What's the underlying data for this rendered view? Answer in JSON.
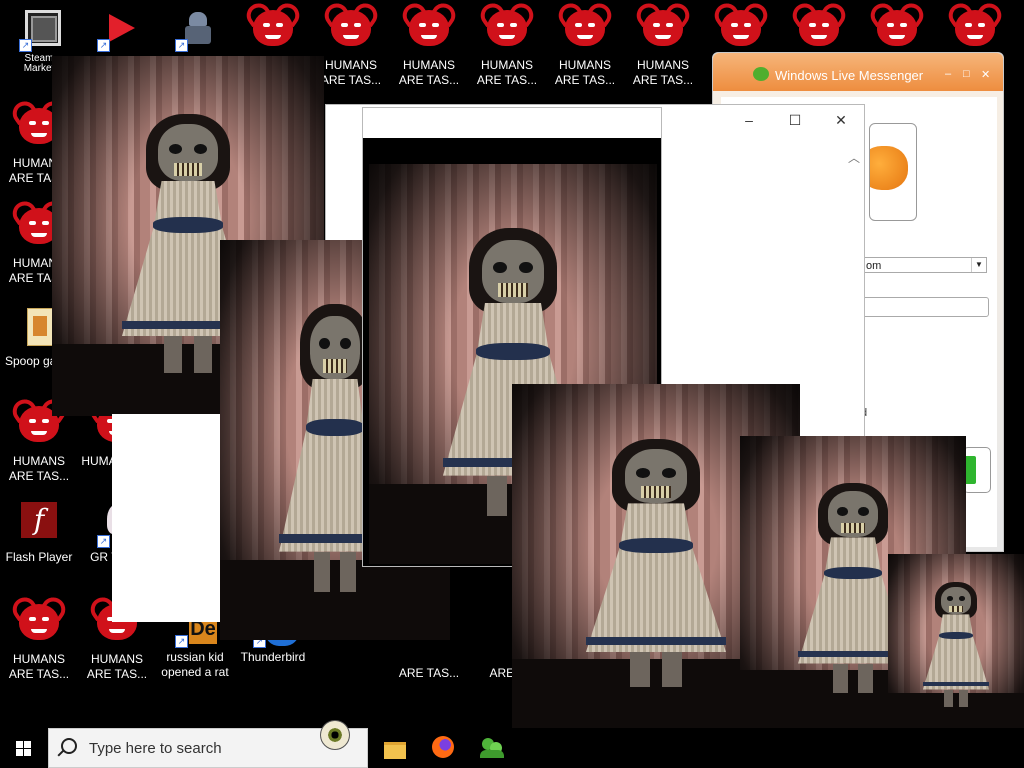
{
  "desktop": {
    "icons": [
      {
        "label": "HUMANS ARE TAS...",
        "type": "demon"
      },
      {
        "label": "HUMANS ARE TAS...",
        "type": "demon"
      },
      {
        "label": "Spoop game",
        "type": "game"
      },
      {
        "label": "HUMANS ARE TAS...",
        "type": "demon"
      },
      {
        "label": "HUMAN ARE T",
        "type": "demon"
      },
      {
        "label": "Flash Player",
        "type": "flash"
      },
      {
        "label": "GR THER",
        "type": "other"
      },
      {
        "label": "HUMANS ARE TAS...",
        "type": "demon"
      },
      {
        "label": "HUMANS ARE TAS...",
        "type": "demon"
      },
      {
        "label": "russian kid opened a rat",
        "type": "video"
      },
      {
        "label": "Thunderbird",
        "type": "mail"
      }
    ],
    "top_row_label": "HUMANS\nARE TAS...",
    "bottom_row_label_1": "ARE TAS...",
    "bottom_row_label_2": "ARE T",
    "corner_label": "Steam\nMarket"
  },
  "messenger": {
    "title": "Windows Live Messenger",
    "email_value": "om",
    "d_text": "d"
  },
  "taskbar": {
    "search_placeholder": "Type here to search"
  },
  "colors": {
    "demon_red": "#d0111a",
    "messenger_orange": "#ee8d3f",
    "taskbar": "#000000"
  }
}
